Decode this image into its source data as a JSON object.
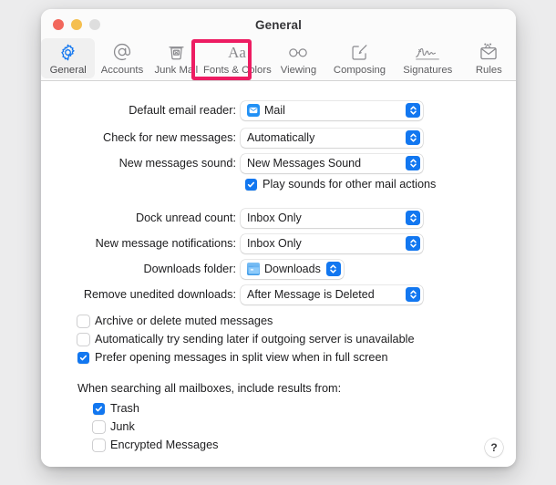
{
  "window": {
    "title": "General",
    "traffic_lights": [
      "close",
      "minimize",
      "zoom"
    ]
  },
  "toolbar": {
    "items": [
      {
        "id": "general",
        "label": "General",
        "icon": "gear-icon",
        "selected": true,
        "highlighted": false
      },
      {
        "id": "accounts",
        "label": "Accounts",
        "icon": "at-sign-icon",
        "selected": false,
        "highlighted": false
      },
      {
        "id": "junk-mail",
        "label": "Junk Mail",
        "icon": "trash-x-icon",
        "selected": false,
        "highlighted": true
      },
      {
        "id": "fonts-colors",
        "label": "Fonts & Colors",
        "icon": "aa-text-icon",
        "selected": false,
        "highlighted": false
      },
      {
        "id": "viewing",
        "label": "Viewing",
        "icon": "glasses-icon",
        "selected": false,
        "highlighted": false
      },
      {
        "id": "composing",
        "label": "Composing",
        "icon": "compose-pencil-icon",
        "selected": false,
        "highlighted": false
      },
      {
        "id": "signatures",
        "label": "Signatures",
        "icon": "signature-icon",
        "selected": false,
        "highlighted": false
      },
      {
        "id": "rules",
        "label": "Rules",
        "icon": "envelope-rules-icon",
        "selected": false,
        "highlighted": false
      }
    ],
    "highlight_color": "#ed1c62"
  },
  "settings": {
    "default_email_reader": {
      "label": "Default email reader:",
      "value": "Mail",
      "icon": "mail-app-icon"
    },
    "check_for_new_messages": {
      "label": "Check for new messages:",
      "value": "Automatically"
    },
    "new_messages_sound": {
      "label": "New messages sound:",
      "value": "New Messages Sound"
    },
    "play_sounds": {
      "label": "Play sounds for other mail actions",
      "checked": true
    },
    "dock_unread_count": {
      "label": "Dock unread count:",
      "value": "Inbox Only"
    },
    "new_message_notifications": {
      "label": "New message notifications:",
      "value": "Inbox Only"
    },
    "downloads_folder": {
      "label": "Downloads folder:",
      "value": "Downloads",
      "icon": "downloads-folder-icon"
    },
    "remove_unedited_downloads": {
      "label": "Remove unedited downloads:",
      "value": "After Message is Deleted"
    }
  },
  "options": [
    {
      "id": "archive-muted",
      "label": "Archive or delete muted messages",
      "checked": false
    },
    {
      "id": "auto-send-later",
      "label": "Automatically try sending later if outgoing server is unavailable",
      "checked": false
    },
    {
      "id": "prefer-split-view",
      "label": "Prefer opening messages in split view when in full screen",
      "checked": true
    }
  ],
  "search_section": {
    "title": "When searching all mailboxes, include results from:",
    "items": [
      {
        "id": "trash",
        "label": "Trash",
        "checked": true
      },
      {
        "id": "junk",
        "label": "Junk",
        "checked": false
      },
      {
        "id": "encrypted-messages",
        "label": "Encrypted Messages",
        "checked": false
      }
    ]
  },
  "help": {
    "label": "?"
  },
  "colors": {
    "accent": "#1277f0",
    "highlight": "#ed1c62",
    "window_bg": "#ffffff",
    "desktop_bg": "#ececed"
  }
}
